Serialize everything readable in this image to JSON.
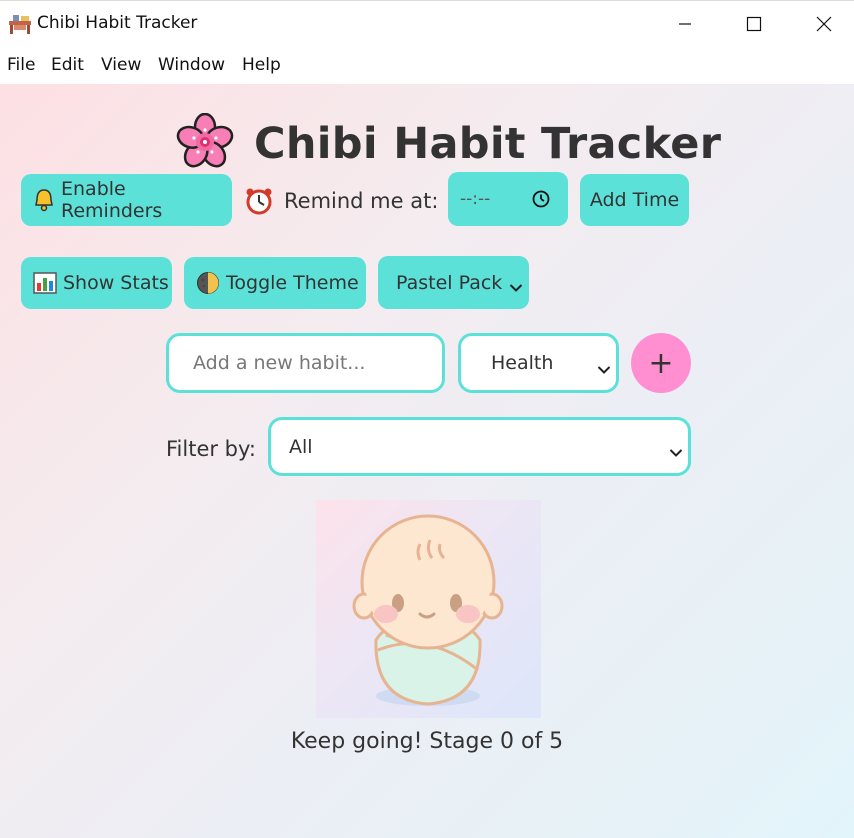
{
  "window": {
    "title": "Chibi Habit Tracker",
    "app_icon": "desk-icon"
  },
  "menu": [
    "File",
    "Edit",
    "View",
    "Window",
    "Help"
  ],
  "header": {
    "title": "Chibi Habit Tracker",
    "icon": "cherry-blossom-icon"
  },
  "reminders": {
    "enable_label": "Enable Reminders",
    "remind_label": "Remind me at:",
    "time_value": "--:--",
    "add_time_label": "Add Time"
  },
  "toolbar": {
    "stats_label": "Show Stats",
    "theme_label": "Toggle Theme",
    "pack_selected": "Pastel Pack"
  },
  "new_habit": {
    "placeholder": "Add a new habit...",
    "category_selected": "Health",
    "add_label": "+"
  },
  "filter": {
    "label": "Filter by:",
    "selected": "All"
  },
  "progress": {
    "message": "Keep going! Stage 0 of 5",
    "stage": 0,
    "max_stage": 5
  },
  "colors": {
    "accent": "#5ce1d9",
    "add_button": "#ff8fd0",
    "text": "#333333"
  }
}
